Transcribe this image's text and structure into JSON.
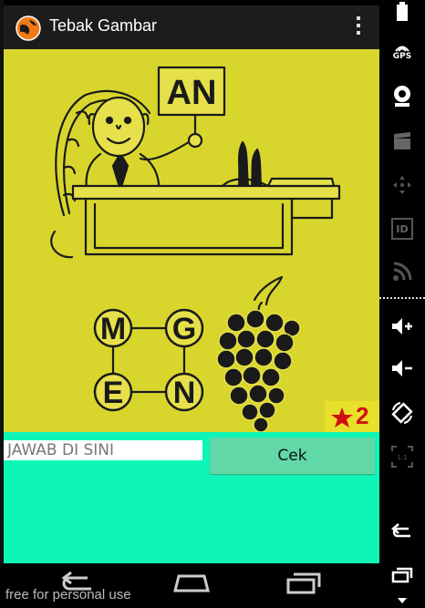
{
  "app": {
    "title": "Tebak Gambar"
  },
  "puzzle": {
    "sign_text": "AN",
    "letters": [
      "M",
      "G",
      "E",
      "N"
    ],
    "score": "2"
  },
  "answer": {
    "placeholder": "JAWAB DI SINI",
    "button_label": "Cek"
  },
  "side_panel": {
    "gps_label": "GPS",
    "id_label": "ID",
    "scale_label": "1:1"
  },
  "watermark": "free for personal use",
  "colors": {
    "puzzle_bg": "#d8d62c",
    "answer_bg": "#0ef5b8",
    "button": "#61d8a8",
    "actionbar": "#1c1c1c",
    "score": "#d01010"
  }
}
